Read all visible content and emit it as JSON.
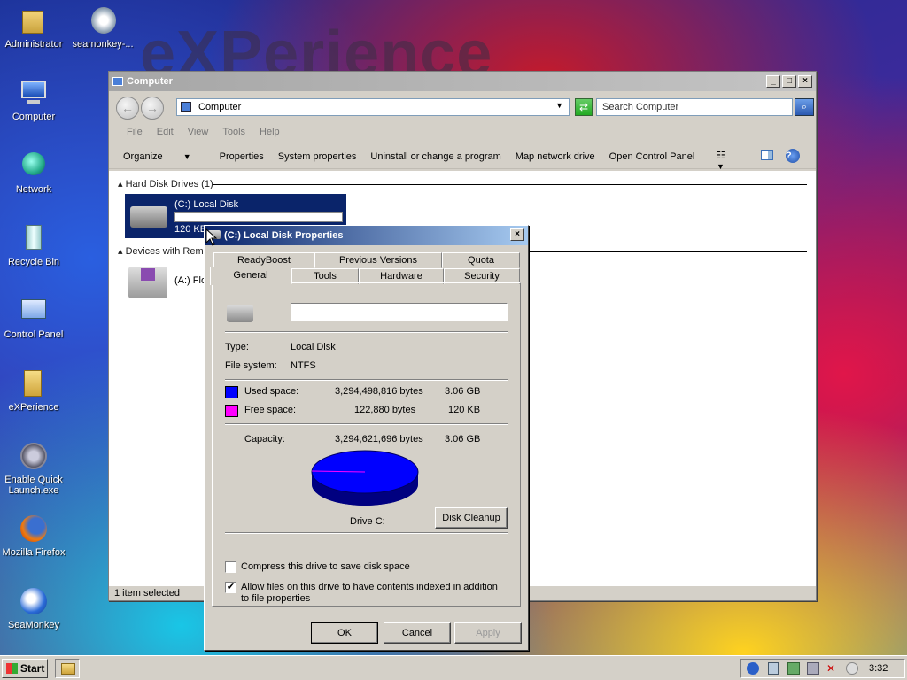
{
  "desktop": {
    "watermark": "eXPerience",
    "icons": [
      {
        "label": "Administrator",
        "icon": "folder-user-icon"
      },
      {
        "label": "seamonkey-...",
        "icon": "installer-icon"
      },
      {
        "label": "Computer",
        "icon": "computer-icon"
      },
      {
        "label": "Network",
        "icon": "network-icon"
      },
      {
        "label": "Recycle Bin",
        "icon": "recycle-bin-icon"
      },
      {
        "label": "Control Panel",
        "icon": "control-panel-icon"
      },
      {
        "label": "eXPerience",
        "icon": "folder-icon"
      },
      {
        "label": "Enable Quick Launch.exe",
        "icon": "executable-icon"
      },
      {
        "label": "Mozilla Firefox",
        "icon": "firefox-icon"
      },
      {
        "label": "SeaMonkey",
        "icon": "seamonkey-icon"
      }
    ]
  },
  "explorer": {
    "title": "Computer",
    "address": "Computer",
    "search_placeholder": "Search Computer",
    "menu": [
      "File",
      "Edit",
      "View",
      "Tools",
      "Help"
    ],
    "commands": [
      "Organize",
      "Properties",
      "System properties",
      "Uninstall or change a program",
      "Map network drive",
      "Open Control Panel"
    ],
    "groups": {
      "hard_disks": "Hard Disk Drives (1)",
      "removable": "Devices with Removable Storage (1)"
    },
    "drive_c": {
      "name": "(C:) Local Disk",
      "free": "120 KB free of 3.06 GB",
      "free_fraction": 4e-05
    },
    "drive_a": {
      "name": "(A:) Floppy Disk Drive"
    },
    "status": "1 item selected"
  },
  "dialog": {
    "title": "(C:) Local Disk Properties",
    "tabs_back": [
      "ReadyBoost",
      "Previous Versions",
      "Quota"
    ],
    "tabs_front": [
      "General",
      "Tools",
      "Hardware",
      "Security"
    ],
    "active_tab": "General",
    "label_value": "",
    "type_label": "Type:",
    "type_value": "Local Disk",
    "fs_label": "File system:",
    "fs_value": "NTFS",
    "used_label": "Used space:",
    "used_bytes": "3,294,498,816 bytes",
    "used_size": "3.06 GB",
    "free_label": "Free space:",
    "free_bytes": "122,880 bytes",
    "free_size": "120 KB",
    "capacity_label": "Capacity:",
    "capacity_bytes": "3,294,621,696 bytes",
    "capacity_size": "3.06 GB",
    "drive_caption": "Drive C:",
    "cleanup_button": "Disk Cleanup",
    "compress_label": "Compress this drive to save disk space",
    "compress_checked": false,
    "index_label": "Allow files on this drive to have contents indexed in addition to file properties",
    "index_checked": true,
    "ok": "OK",
    "cancel": "Cancel",
    "apply": "Apply",
    "used_color": "#0000ff",
    "free_color": "#ff00ff"
  },
  "taskbar": {
    "start": "Start",
    "clock": "3:32"
  }
}
